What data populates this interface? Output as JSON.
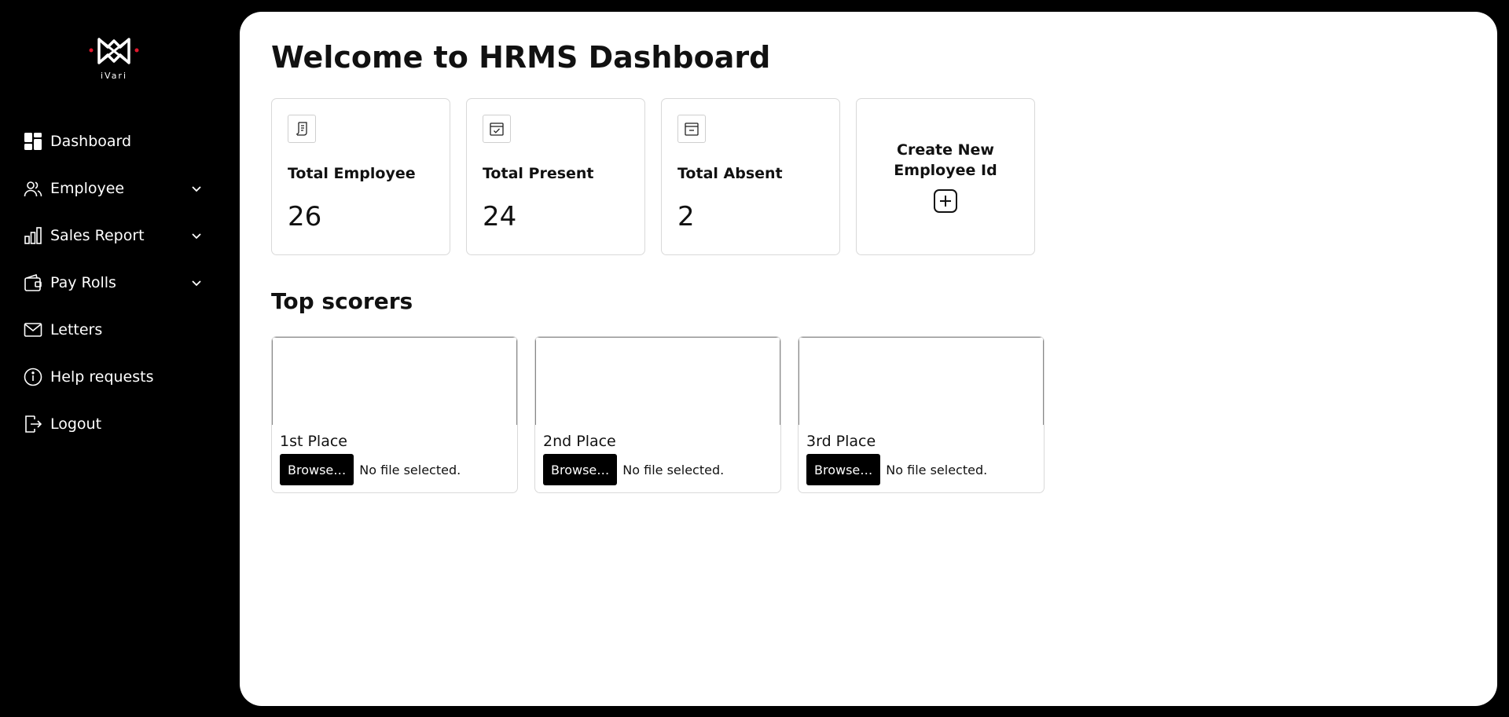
{
  "brand": {
    "logo_text": "iVari",
    "accent_color": "#e0182d"
  },
  "sidebar": {
    "items": [
      {
        "label": "Dashboard",
        "icon": "dashboard-icon",
        "has_chevron": false
      },
      {
        "label": "Employee",
        "icon": "users-icon",
        "has_chevron": true
      },
      {
        "label": "Sales Report",
        "icon": "bar-chart-icon",
        "has_chevron": true
      },
      {
        "label": "Pay Rolls",
        "icon": "wallet-icon",
        "has_chevron": true
      },
      {
        "label": "Letters",
        "icon": "mail-icon",
        "has_chevron": false
      },
      {
        "label": "Help requests",
        "icon": "info-icon",
        "has_chevron": false
      },
      {
        "label": "Logout",
        "icon": "logout-icon",
        "has_chevron": false
      }
    ]
  },
  "main": {
    "title": "Welcome to HRMS Dashboard",
    "stats": [
      {
        "label": "Total Employee",
        "value": "26",
        "icon": "receipt-icon"
      },
      {
        "label": "Total Present",
        "value": "24",
        "icon": "calendar-check-icon"
      },
      {
        "label": "Total Absent",
        "value": "2",
        "icon": "calendar-minus-icon"
      }
    ],
    "create": {
      "label": "Create New Employee Id",
      "icon": "plus-square-icon"
    },
    "top_scorers": {
      "title": "Top scorers",
      "items": [
        {
          "place": "1st Place",
          "button": "Browse…",
          "status": "No file selected."
        },
        {
          "place": "2nd Place",
          "button": "Browse…",
          "status": "No file selected."
        },
        {
          "place": "3rd Place",
          "button": "Browse…",
          "status": "No file selected."
        }
      ]
    }
  }
}
